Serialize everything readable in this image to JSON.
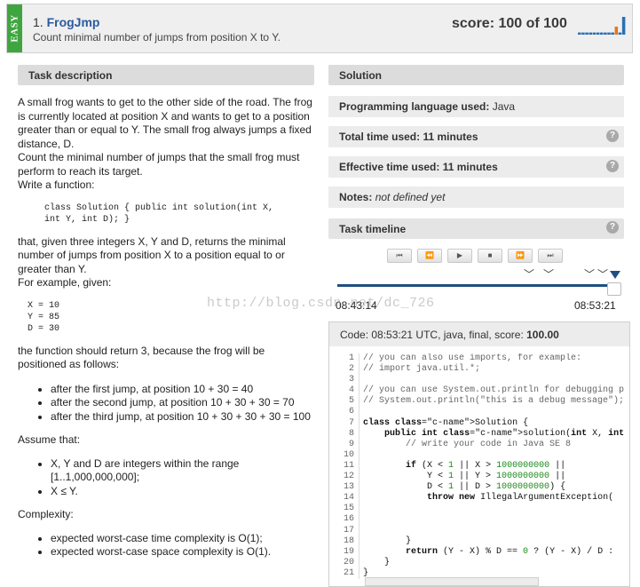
{
  "header": {
    "difficulty": "EASY",
    "task_number": "1.",
    "task_name": "FrogJmp",
    "task_subtitle": "Count minimal number of jumps from position X to Y.",
    "score_text": "score: 100 of 100",
    "score_chart": {
      "bars": [
        0.12,
        0.12,
        0.12,
        0.12,
        0.12,
        0.12,
        0.12,
        0.12,
        0.12,
        0.12,
        0.45,
        0.12,
        1.0
      ],
      "bar_color": "#2a6fb5",
      "highlight_color": "#e07a1f"
    }
  },
  "left": {
    "section_title": "Task description",
    "paragraph1": "A small frog wants to get to the other side of the road. The frog is currently located at position X and wants to get to a position greater than or equal to Y. The small frog always jumps a fixed distance, D.",
    "paragraph2": "Count the minimal number of jumps that the small frog must perform to reach its target.",
    "paragraph3": "Write a function:",
    "signature": "class Solution { public int solution(int X,\nint Y, int D); }",
    "paragraph4": "that, given three integers X, Y and D, returns the minimal number of jumps from position X to a position equal to or greater than Y.",
    "paragraph5": "For example, given:",
    "example": "X = 10\nY = 85\nD = 30",
    "paragraph6": "the function should return 3, because the frog will be positioned as follows:",
    "jumps": [
      "after the first jump, at position 10 + 30 = 40",
      "after the second jump, at position 10 + 30 + 30 = 70",
      "after the third jump, at position 10 + 30 + 30 + 30 = 100"
    ],
    "assume_label": "Assume that:",
    "assumptions": [
      "X, Y and D are integers within the range [1..1,000,000,000];",
      "X ≤ Y."
    ],
    "complexity_label": "Complexity:",
    "complexity": [
      "expected worst-case time complexity is O(1);",
      "expected worst-case space complexity is O(1)."
    ]
  },
  "right": {
    "section_title": "Solution",
    "language_label": "Programming language used:",
    "language_value": "Java",
    "total_time_label": "Total time used:",
    "total_time_value": "11 minutes",
    "effective_time_label": "Effective time used:",
    "effective_time_value": "11 minutes",
    "notes_label": "Notes:",
    "notes_value": "not defined yet",
    "timeline_title": "Task timeline",
    "help_glyph": "?",
    "controls": [
      "⏮",
      "⏪",
      "▶",
      "■",
      "⏩",
      "⏭"
    ],
    "timeline_start": "08:43:14",
    "timeline_end": "08:53:21",
    "watermark": "http://blog.csdn.net/dc_726"
  },
  "code": {
    "header_prefix": "Code: 08:53:21 UTC, java, final, score: ",
    "header_score": "100.00",
    "line_numbers": [
      "1",
      "2",
      "3",
      "4",
      "5",
      "6",
      "7",
      "8",
      "9",
      "10",
      "11",
      "12",
      "13",
      "14",
      "15",
      "16",
      "17",
      "18",
      "19",
      "20",
      "21"
    ],
    "lines": [
      "// you can also use imports, for example:",
      "// import java.util.*;",
      "",
      "// you can use System.out.println for debugging p",
      "// System.out.println(\"this is a debug message\");",
      "",
      "class Solution {",
      "    public int solution(int X, int Y, int D)",
      "        // write your code in Java SE 8",
      "",
      "        if (X < 1 || X > 1000000000 ||",
      "            Y < 1 || Y > 1000000000 ||",
      "            D < 1 || D > 1000000000) {",
      "            throw new IllegalArgumentException(",
      "",
      "",
      "",
      "        }",
      "        return (Y - X) % D == 0 ? (Y - X) / D :",
      "    }",
      "}"
    ]
  }
}
